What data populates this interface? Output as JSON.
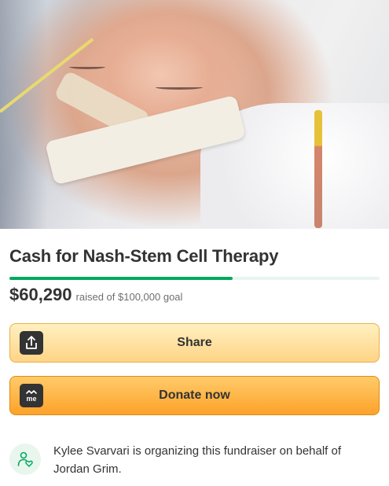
{
  "hero": {
    "image_alt": "Infant sleeping in hospital bed with breathing tube taped to face"
  },
  "fundraiser": {
    "title": "Cash for Nash-Stem Cell Therapy",
    "raised": "$60,290",
    "goal_text": "raised of $100,000 goal",
    "progress_fraction": 0.6029
  },
  "buttons": {
    "share_label": "Share",
    "donate_label": "Donate now"
  },
  "icons": {
    "share": "share-icon",
    "donate": "gofundme-icon",
    "organizer": "heart-person-icon"
  },
  "organizer": {
    "text": "Kylee Svarvari is organizing this fundraiser on behalf of Jordan Grim."
  },
  "colors": {
    "progress": "#02a95c",
    "share_bg": "#ffe3a0",
    "donate_bg": "#fdb040",
    "text": "#333333"
  }
}
